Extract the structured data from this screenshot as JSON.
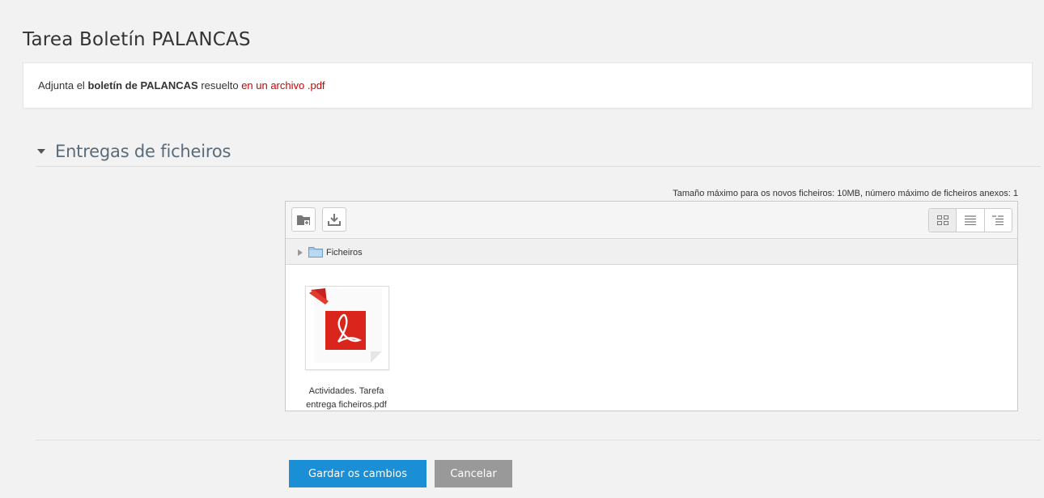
{
  "page": {
    "title": "Tarea Boletín PALANCAS"
  },
  "intro": {
    "part1": "Adjunta el ",
    "bold": "boletín de PALANCAS",
    "part2": " resuelto ",
    "accent": "en un archivo .pdf"
  },
  "section": {
    "title": "Entregas de ficheiros"
  },
  "filemanager": {
    "info": "Tamaño máximo para os novos ficheiros: 10MB, número máximo de ficheiros anexos: 1",
    "toolbar": {
      "add_icon": "add-file-icon",
      "download_icon": "download-icon",
      "views": [
        "icons-view-icon",
        "list-view-icon",
        "tree-view-icon"
      ]
    },
    "path_label": "Ficheiros",
    "files": [
      {
        "name_line1": "Actividades. Tarefa",
        "name_line2": "entrega ficheiros.pdf",
        "icon": "pdf-icon"
      }
    ]
  },
  "actions": {
    "save_label": "Gardar os cambios",
    "cancel_label": "Cancelar"
  },
  "colors": {
    "primary": "#1b8fd6",
    "secondary": "#999999",
    "accent_text": "#cc0000",
    "pdf_red": "#d9251c"
  }
}
